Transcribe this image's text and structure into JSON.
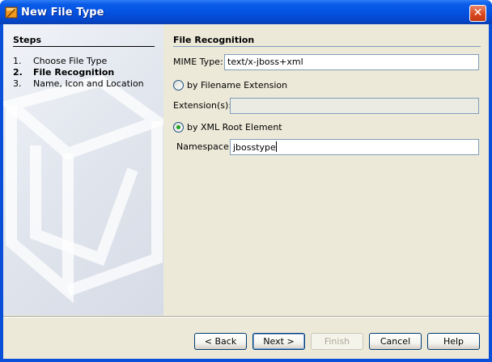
{
  "window": {
    "title": "New File Type",
    "close_glyph": "✕",
    "title_icon": "project-icon"
  },
  "steps": {
    "title": "Steps",
    "items": [
      {
        "num": "1.",
        "label": "Choose File Type"
      },
      {
        "num": "2.",
        "label": "File Recognition"
      },
      {
        "num": "3.",
        "label": "Name, Icon and Location"
      }
    ]
  },
  "form": {
    "section_title": "File Recognition",
    "mime_label": "MIME Type:",
    "mime_value": "text/x-jboss+xml",
    "radio_extension_label": "by Filename Extension",
    "extensions_label": "Extension(s):",
    "extensions_value": "",
    "radio_xml_label": "by XML Root Element",
    "namespace_label": "Namespace:",
    "namespace_value": "jbosstype"
  },
  "buttons": {
    "back": "< Back",
    "next": "Next >",
    "finish": "Finish",
    "cancel": "Cancel",
    "help": "Help"
  }
}
